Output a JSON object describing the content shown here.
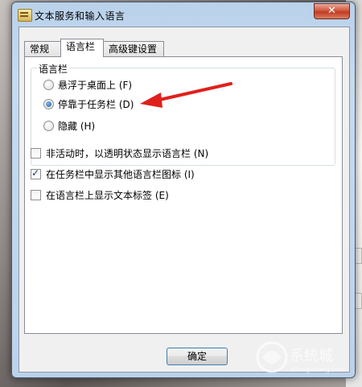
{
  "window": {
    "title": "文本服务和输入语言",
    "close_glyph": "✕"
  },
  "tabs": [
    {
      "label": "常规"
    },
    {
      "label": "语言栏"
    },
    {
      "label": "高级键设置"
    }
  ],
  "group": {
    "title": "语言栏"
  },
  "radios": [
    {
      "label": "悬浮于桌面上 (F)",
      "selected": false
    },
    {
      "label": "停靠于任务栏 (D)",
      "selected": true
    },
    {
      "label": "隐藏 (H)",
      "selected": false
    }
  ],
  "checks": [
    {
      "label": "非活动时，以透明状态显示语言栏 (N)",
      "checked": false
    },
    {
      "label": "在任务栏中显示其他语言栏图标 (I)",
      "checked": true
    },
    {
      "label": "在语言栏上显示文本标签 (E)",
      "checked": false
    }
  ],
  "buttons": {
    "ok": "确定"
  },
  "annotation": {
    "arrow_color": "#e0201b"
  },
  "watermark": {
    "text": "系统城",
    "sub": "xitongcheng.com"
  }
}
